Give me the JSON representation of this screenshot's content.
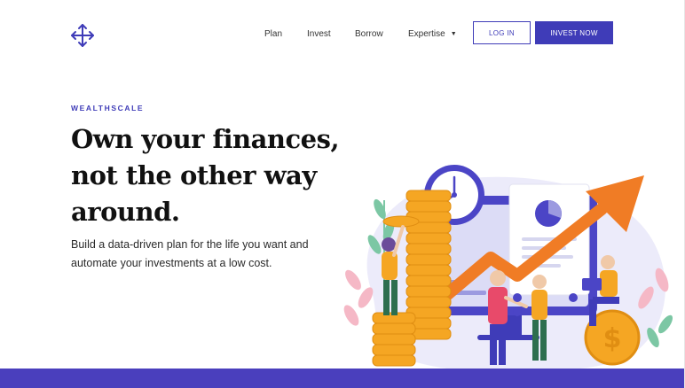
{
  "nav": {
    "links": [
      "Plan",
      "Invest",
      "Borrow",
      "Expertise"
    ],
    "login_label": "LOG IN",
    "invest_label": "INVEST NOW"
  },
  "hero": {
    "eyebrow": "WEALTHSCALE",
    "headline_line1": "Own your finances,",
    "headline_line2": "not the other way",
    "headline_line3": "around.",
    "subhead": "Build a data-driven plan for the life you want and automate your investments at a low cost."
  },
  "icons": {
    "logo": "move-arrows-icon",
    "expertise_caret": "caret-down-icon",
    "illustration": "finance-growth-illustration"
  },
  "colors": {
    "brand": "#3f3cb8",
    "coin": "#f5a623",
    "arrow": "#f07c25",
    "footer": "#4a3fbd"
  }
}
